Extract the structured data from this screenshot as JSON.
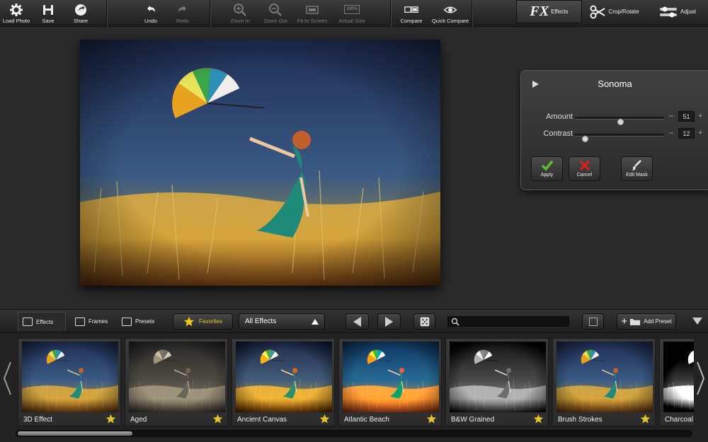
{
  "toolbar": {
    "load_photo": "Load Photo",
    "save": "Save",
    "share": "Share",
    "undo": "Undo",
    "redo": "Redo",
    "zoom_in": "Zoom In",
    "zoom_out": "Zoom Out",
    "fit_to_screen": "Fit to Screen",
    "actual_size_badge": "100%",
    "actual_size": "Actual Size",
    "compare": "Compare",
    "quick_compare": "Quick Compare",
    "effects_logo": "FX",
    "effects": "Effects",
    "crop_rotate": "Crop/Rotate",
    "adjust": "Adjust"
  },
  "effect_panel": {
    "title": "Sonoma",
    "sliders": [
      {
        "label": "Amount",
        "value": "51",
        "level": 0.51
      },
      {
        "label": "Contrast",
        "value": "12",
        "level": 0.12
      }
    ],
    "minus": "–",
    "plus": "+",
    "apply": "Apply",
    "cancel": "Cancel",
    "edit_mask": "Edit Mask"
  },
  "browser": {
    "tab_effects": "Effects",
    "tab_frames": "Frames",
    "tab_presets": "Presets",
    "favorites": "Favorites",
    "dropdown_selected": "All Effects",
    "search_placeholder": "",
    "add_preset": "Add Preset",
    "thumbnails": [
      {
        "label": "3D Effect",
        "style": "color"
      },
      {
        "label": "Aged",
        "style": "aged"
      },
      {
        "label": "Ancient Canvas",
        "style": "warm"
      },
      {
        "label": "Atlantic Beach",
        "style": "teal"
      },
      {
        "label": "B&W Grained",
        "style": "bw"
      },
      {
        "label": "Brush Strokes",
        "style": "color"
      },
      {
        "label": "Charcoal",
        "style": "charcoal"
      }
    ],
    "scroll_fraction": 0.17
  },
  "colors": {
    "favorite_gold": "#e3c42b",
    "apply_green": "#5bbf2e",
    "cancel_red": "#d62020"
  }
}
